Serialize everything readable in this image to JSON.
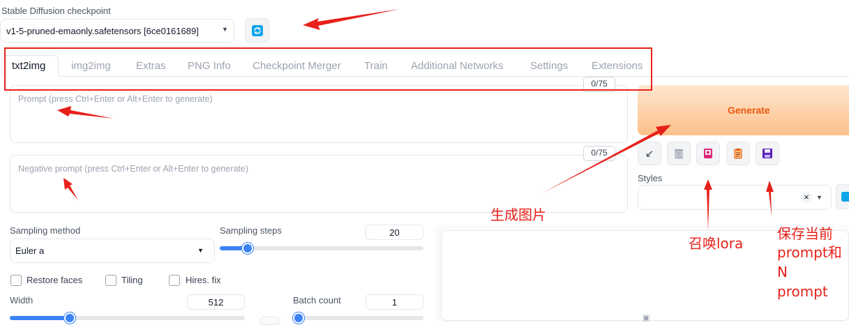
{
  "checkpoint": {
    "label": "Stable Diffusion checkpoint",
    "selected": "v1-5-pruned-emaonly.safetensors [6ce0161689]"
  },
  "tabs": [
    "txt2img",
    "img2img",
    "Extras",
    "PNG Info",
    "Checkpoint Merger",
    "Train",
    "Additional Networks",
    "Settings",
    "Extensions"
  ],
  "prompt": {
    "placeholder": "Prompt (press Ctrl+Enter or Alt+Enter to generate)",
    "counter": "0/75"
  },
  "negative_prompt": {
    "placeholder": "Negative prompt (press Ctrl+Enter or Alt+Enter to generate)",
    "counter": "0/75"
  },
  "generate": {
    "label": "Generate"
  },
  "styles": {
    "label": "Styles",
    "clear": "×"
  },
  "sampling": {
    "method_label": "Sampling method",
    "method_value": "Euler a",
    "steps_label": "Sampling steps",
    "steps_value": "20",
    "steps_fraction": 0.13
  },
  "options": [
    "Restore faces",
    "Tiling",
    "Hires. fix"
  ],
  "width": {
    "label": "Width",
    "value": "512",
    "fraction": 0.25
  },
  "batch_count": {
    "label": "Batch count",
    "value": "1",
    "fraction": 0.0
  },
  "annotations": {
    "generate_note": "生成图片",
    "lora_note": "召唤lora",
    "save_note_lines": [
      "保存当前",
      "prompt和",
      "N",
      "prompt"
    ]
  },
  "colors": {
    "annotation_red": "#e8201a",
    "generate_gradient_start": "#fde2c7",
    "generate_gradient_end": "#fdba74",
    "accent_blue": "#0ea5e9"
  }
}
